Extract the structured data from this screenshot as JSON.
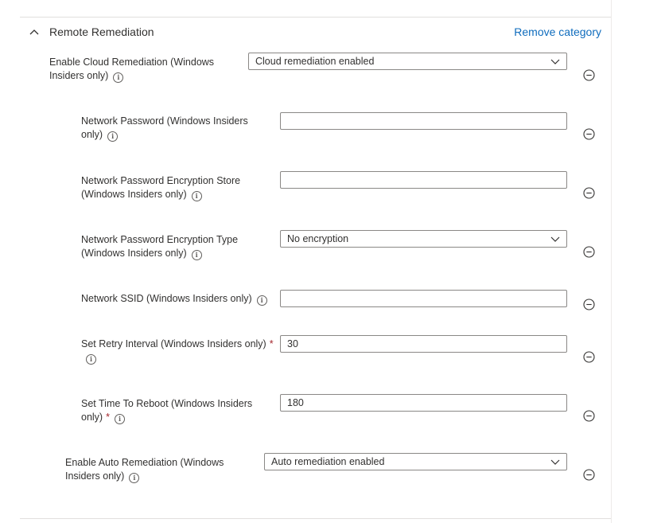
{
  "section": {
    "title": "Remote Remediation",
    "remove_label": "Remove category"
  },
  "settings": [
    {
      "label": "Enable Cloud Remediation (Windows Insiders only)",
      "value": "Cloud remediation enabled",
      "type": "select",
      "required": false
    },
    {
      "label": "Network Password (Windows Insiders only)",
      "value": "",
      "type": "text",
      "required": false
    },
    {
      "label": "Network Password Encryption Store (Windows Insiders only)",
      "value": "",
      "type": "text",
      "required": false
    },
    {
      "label": "Network Password Encryption Type (Windows Insiders only)",
      "value": "No encryption",
      "type": "select",
      "required": false
    },
    {
      "label": "Network SSID (Windows Insiders only)",
      "value": "",
      "type": "text",
      "required": false
    },
    {
      "label": "Set Retry Interval (Windows Insiders only)",
      "value": "30",
      "type": "text",
      "required": true
    },
    {
      "label": "Set Time To Reboot (Windows Insiders only)",
      "value": "180",
      "type": "text",
      "required": true
    },
    {
      "label": "Enable Auto Remediation (Windows Insiders only)",
      "value": "Auto remediation enabled",
      "type": "select",
      "required": false
    }
  ],
  "required_marker": "*",
  "icons": {
    "collapse": "chevron-up-icon",
    "info": "info-icon",
    "dropdown": "chevron-down-icon",
    "remove": "minus-circle-icon"
  },
  "colors": {
    "link": "#0f6cbd",
    "required": "#a4262c",
    "border": "#8a8886"
  }
}
